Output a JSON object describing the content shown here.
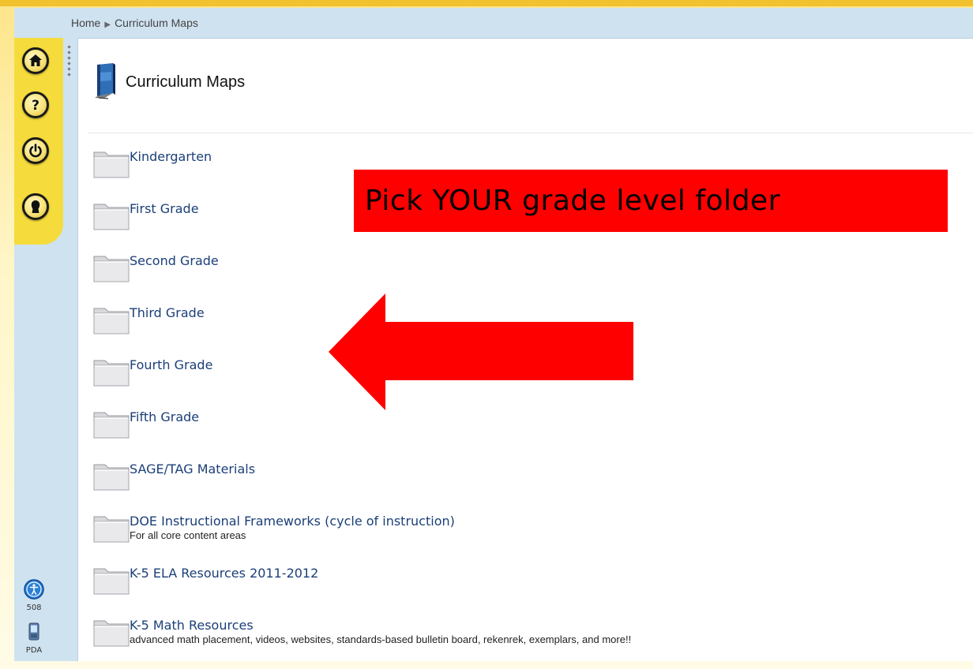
{
  "breadcrumb": {
    "home": "Home",
    "current": "Curriculum Maps"
  },
  "page": {
    "title": "Curriculum Maps",
    "title_icon": "book-icon"
  },
  "rail": {
    "buttons": [
      {
        "icon": "home-icon"
      },
      {
        "icon": "help-icon"
      },
      {
        "icon": "power-icon"
      },
      {
        "icon": "user-profile-icon"
      }
    ],
    "bottom": [
      {
        "icon": "accessibility-icon",
        "label": "508"
      },
      {
        "icon": "pda-icon",
        "label": "PDA"
      }
    ]
  },
  "folders": [
    {
      "name": "Kindergarten",
      "desc": ""
    },
    {
      "name": "First Grade",
      "desc": ""
    },
    {
      "name": "Second Grade",
      "desc": ""
    },
    {
      "name": "Third Grade",
      "desc": ""
    },
    {
      "name": "Fourth Grade",
      "desc": ""
    },
    {
      "name": "Fifth Grade",
      "desc": ""
    },
    {
      "name": "SAGE/TAG Materials",
      "desc": ""
    },
    {
      "name": "DOE Instructional Frameworks (cycle of instruction)",
      "desc": "For all core content areas"
    },
    {
      "name": "K-5 ELA Resources 2011-2012",
      "desc": ""
    },
    {
      "name": "K-5 Math Resources",
      "desc": "advanced math placement, videos, websites, standards-based bulletin board, rekenrek, exemplars, and more!!"
    }
  ],
  "annotation": {
    "callout_text": "Pick YOUR grade level folder",
    "callout_color": "#ff0000",
    "arrow_color": "#ff0000",
    "arrow_direction": "left"
  },
  "colors": {
    "link": "#1b3f78",
    "rail_accent": "#f5dc3c",
    "frame": "#cfe2f0"
  }
}
